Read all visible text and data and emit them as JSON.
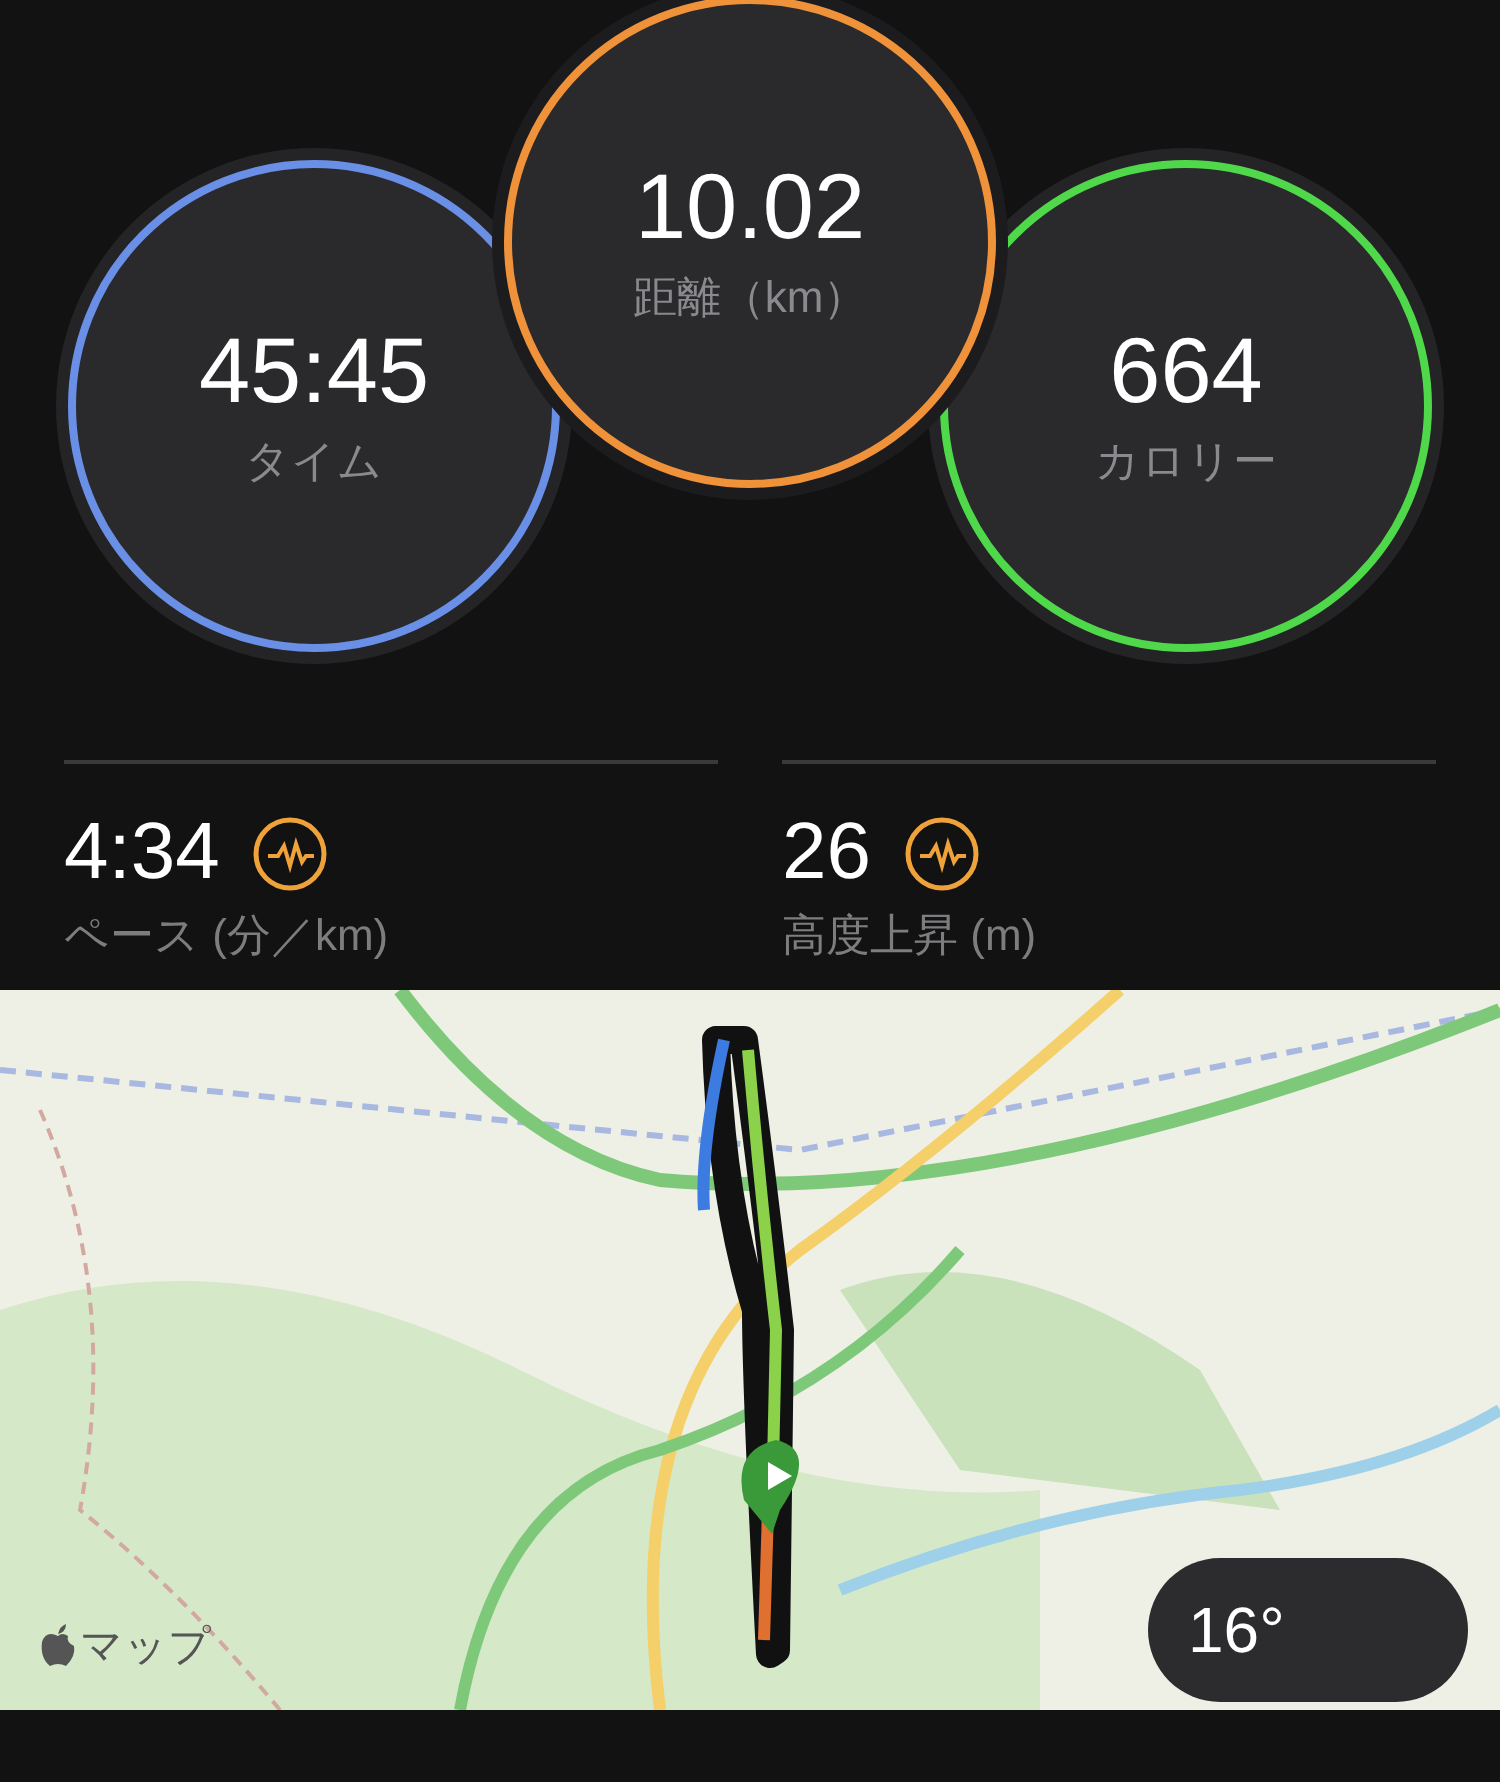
{
  "rings": [
    {
      "value": "45:45",
      "label": "タイム",
      "color": "#6a8fe6"
    },
    {
      "value": "10.02",
      "label": "距離（km）",
      "color": "#f0923a"
    },
    {
      "value": "664",
      "label": "カロリー",
      "color": "#4fd84a"
    }
  ],
  "stats": [
    {
      "value": "4:34",
      "label": "ペース (分／km)"
    },
    {
      "value": "26",
      "label": "高度上昇 (m)"
    }
  ],
  "map": {
    "kind": "picture",
    "attribution": "マップ",
    "temperature": "16°"
  }
}
